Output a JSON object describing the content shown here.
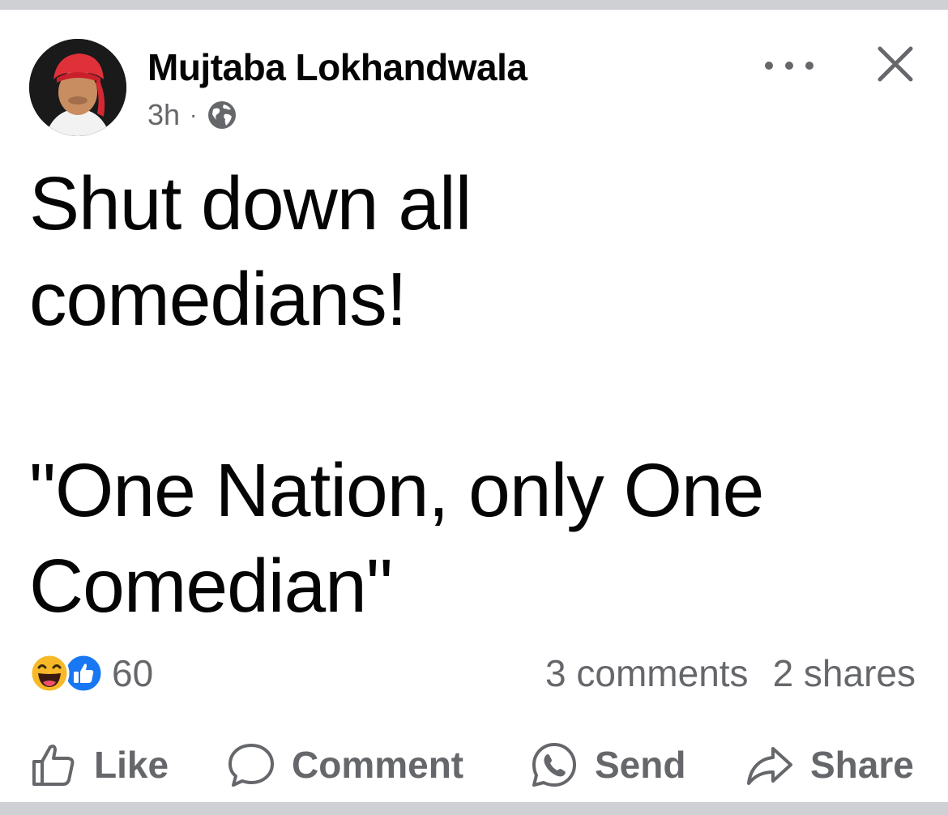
{
  "post": {
    "author_name": "Mujtaba Lokhandwala",
    "time_ago": "3h",
    "separator": "·",
    "privacy_icon": "globe-icon",
    "text_lines": [
      "Shut down all",
      "comedians!",
      "",
      "\"One Nation, only One",
      "Comedian\""
    ]
  },
  "header_actions": {
    "more_icon": "more-dots-icon",
    "close_icon": "close-icon"
  },
  "engagement": {
    "reaction_icons": [
      "haha-reaction-icon",
      "like-reaction-icon"
    ],
    "reaction_count": "60",
    "comments": "3 comments",
    "shares": "2 shares"
  },
  "actions": {
    "like": "Like",
    "comment": "Comment",
    "send": "Send",
    "share": "Share"
  },
  "colors": {
    "text_primary": "#050505",
    "text_secondary": "#65676b",
    "like_blue": "#1877f2",
    "haha_yellow": "#f7b928",
    "frame_gray": "#ced0d4"
  }
}
